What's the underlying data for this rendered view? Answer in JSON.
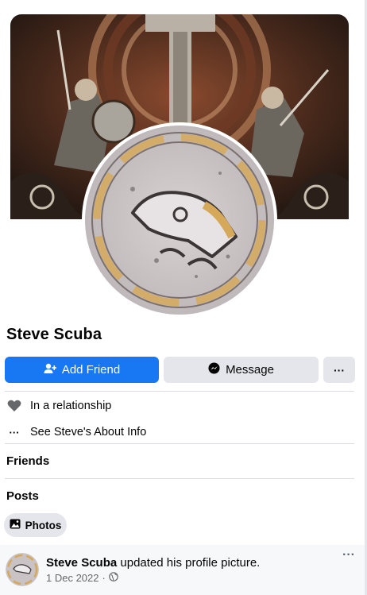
{
  "profile": {
    "name": "Steve Scuba",
    "add_friend_label": "Add Friend",
    "message_label": "Message",
    "more_label": "···"
  },
  "info": {
    "relationship": "In a relationship",
    "about": "See Steve's About Info",
    "about_icon": "···"
  },
  "sections": {
    "friends": "Friends",
    "posts": "Posts"
  },
  "chips": {
    "photos": "Photos"
  },
  "post": {
    "author": "Steve Scuba",
    "action": "updated his profile picture.",
    "date": "1 Dec 2022",
    "separator": "·",
    "more": "···"
  },
  "colors": {
    "primary": "#1877f2",
    "secondary_button": "#e4e6eb",
    "muted_text": "#65676b"
  }
}
